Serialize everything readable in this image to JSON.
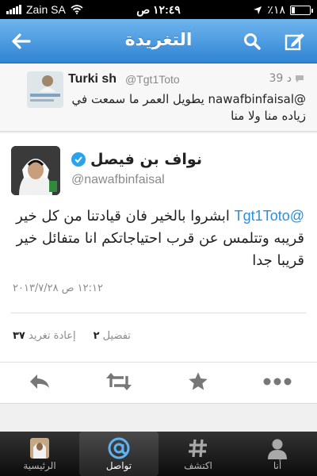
{
  "status_bar": {
    "carrier": "Zain SA",
    "time": "١٢:٤٩ ص",
    "battery_text": "٪١٨",
    "battery_level": 0.18
  },
  "nav": {
    "title": "التغريدة",
    "back_icon": "back-arrow-icon",
    "search_icon": "search-icon",
    "compose_icon": "compose-icon"
  },
  "reply_tweet": {
    "name": "Turki sh",
    "handle": "@Tgt1Toto",
    "time": "39 د",
    "text": "@nawafbinfaisal يطويل العمر ما سمعت في زياده منا ولا منا"
  },
  "tweet": {
    "name": "نواف بن فيصل",
    "handle": "@nawafbinfaisal",
    "mention": "@Tgt1Toto",
    "text": "ابشروا بالخير فان قيادتنا من كل خير قريبه وتتلمس عن قرب احتياجاتكم انا متفائل خير قريبا جدا",
    "timestamp": "١٢:١٢ ص ٢٠١٣/٧/٢٨",
    "favorites_count": "٢",
    "favorites_label": "تفضيل",
    "retweets_count": "٣٧",
    "retweets_label": "إعادة تغريد"
  },
  "actions": {
    "reply_icon": "reply-icon",
    "retweet_icon": "retweet-icon",
    "favorite_icon": "star-icon",
    "more_icon": "more-icon"
  },
  "tabs": [
    {
      "label": "الرئيسية",
      "icon": "home-icon"
    },
    {
      "label": "تواصل",
      "icon": "at-icon"
    },
    {
      "label": "اكتشف",
      "icon": "hashtag-icon"
    },
    {
      "label": "أنا",
      "icon": "person-icon"
    }
  ],
  "colors": {
    "nav_blue": "#2f84d3",
    "mention_blue": "#2a8fdf",
    "verified_blue": "#2aa3ef"
  }
}
